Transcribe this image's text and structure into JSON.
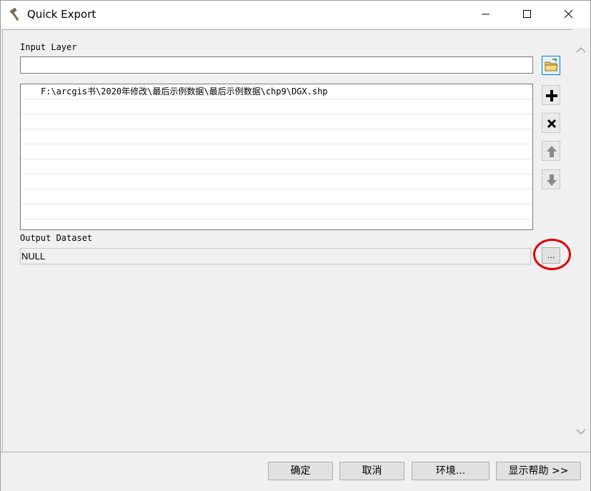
{
  "window": {
    "title": "Quick Export",
    "icon": "hammer-icon",
    "controls": [
      "minimize-icon",
      "maximize-icon",
      "close-icon"
    ]
  },
  "input_layer": {
    "label": "Input Layer",
    "value": "",
    "items": [
      "F:\\arcgis书\\2020年修改\\最后示例数据\\最后示例数据\\chp9\\DGX.shp"
    ]
  },
  "side_buttons": [
    "open-folder-icon",
    "add-icon",
    "remove-icon",
    "move-up-icon",
    "move-down-icon"
  ],
  "output_dataset": {
    "label": "Output Dataset",
    "value": "NULL",
    "browse_label": "..."
  },
  "annotation": {
    "highlight_color": "#e00000"
  },
  "buttons": {
    "ok": "确定",
    "cancel": "取消",
    "environments": "环境...",
    "show_help": "显示帮助 >>"
  }
}
